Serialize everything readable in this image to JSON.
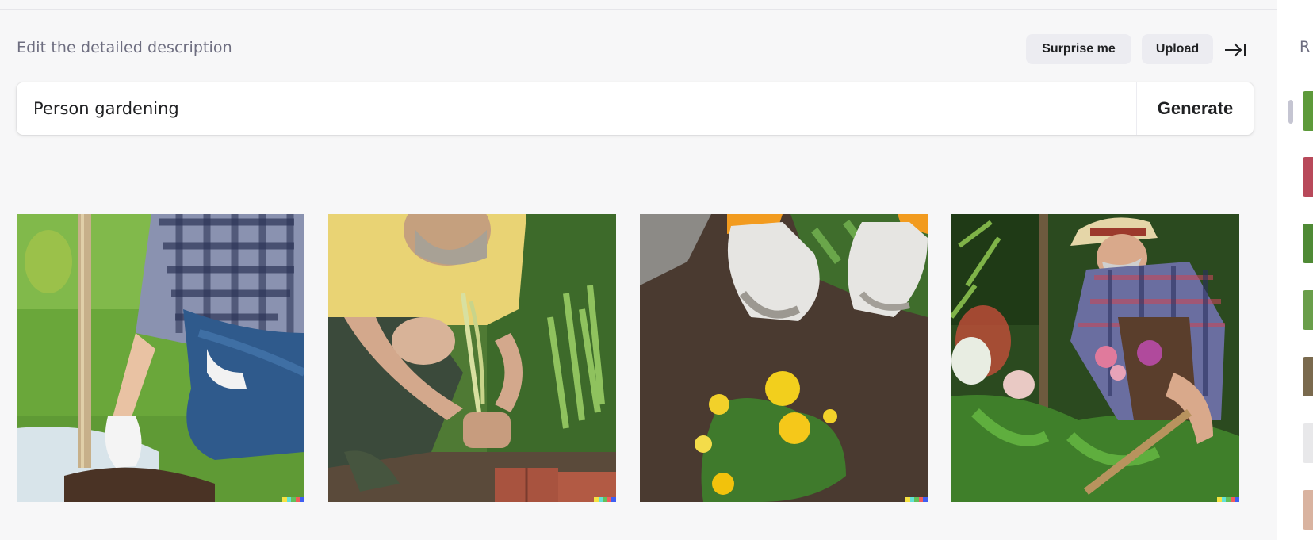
{
  "header": {
    "description_label": "Edit the detailed description",
    "surprise_label": "Surprise me",
    "upload_label": "Upload"
  },
  "prompt": {
    "value": "Person gardening",
    "generate_label": "Generate"
  },
  "gallery": {
    "images": [
      {
        "subject": "person kneeling with spade on lawn"
      },
      {
        "subject": "man in yellow shirt planting"
      },
      {
        "subject": "gloved hands over soil with yellow pansies"
      },
      {
        "subject": "older woman with hat tending flowers"
      }
    ]
  },
  "right_panel": {
    "label": "R"
  },
  "colors": {
    "background": "#f7f7f8",
    "pill": "#ececf1",
    "text": "#202123",
    "muted": "#6e6e80"
  }
}
